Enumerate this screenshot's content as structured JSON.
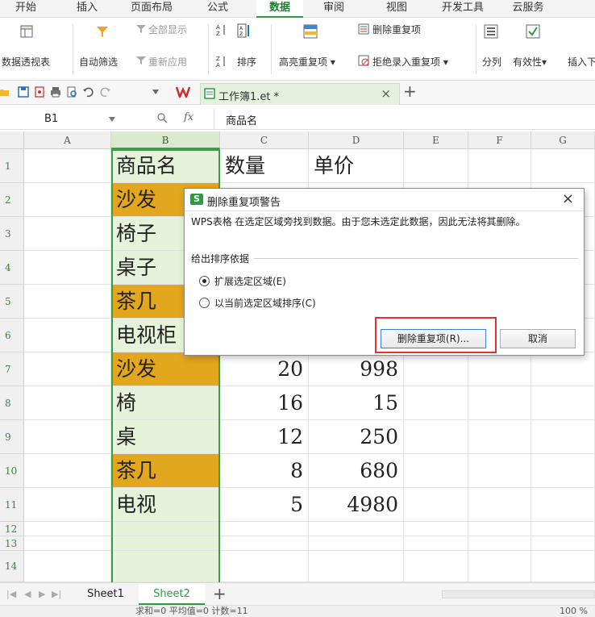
{
  "menu": {
    "tabs": [
      {
        "label": "开始"
      },
      {
        "label": "插入"
      },
      {
        "label": "页面布局"
      },
      {
        "label": "公式"
      },
      {
        "label": "数据",
        "active": true
      },
      {
        "label": "审阅"
      },
      {
        "label": "视图"
      },
      {
        "label": "开发工具"
      },
      {
        "label": "云服务"
      }
    ]
  },
  "ribbon": {
    "pivot": "数据透视表",
    "autofilter": "自动筛选",
    "show_all": "全部显示",
    "reapply": "重新应用",
    "sort": "排序",
    "highlight_dup": "高亮重复项",
    "delete_dup": "删除重复项",
    "reject_dup": "拒绝录入重复项",
    "split": "分列",
    "validity": "有效性",
    "insert_dropdown": "插入下"
  },
  "doc_tab": {
    "title": "工作簿1.et *",
    "close": "×",
    "new": "+"
  },
  "formula_bar": {
    "cell_ref": "B1",
    "fx": "fx",
    "content": "商品名"
  },
  "columns": [
    "A",
    "B",
    "C",
    "D",
    "E",
    "F",
    "G"
  ],
  "rows": [
    "1",
    "2",
    "3",
    "4",
    "5",
    "6",
    "7",
    "8",
    "9",
    "10",
    "11",
    "12",
    "13",
    "14"
  ],
  "table": {
    "headers": [
      "商品名",
      "数量",
      "单价"
    ],
    "records": [
      {
        "name": "沙发",
        "qty": "",
        "price": "",
        "hl": true
      },
      {
        "name": "椅子",
        "qty": "",
        "price": "",
        "hl": false
      },
      {
        "name": "桌子",
        "qty": "",
        "price": "",
        "hl": false
      },
      {
        "name": "茶几",
        "qty": "",
        "price": "",
        "hl": true
      },
      {
        "name": "电视柜",
        "qty": "",
        "price": "",
        "hl": false
      },
      {
        "name": "沙发",
        "qty": "20",
        "price": "998",
        "hl": true
      },
      {
        "name": "椅",
        "qty": "16",
        "price": "15",
        "hl": false
      },
      {
        "name": "桌",
        "qty": "12",
        "price": "250",
        "hl": false
      },
      {
        "name": "茶几",
        "qty": "8",
        "price": "680",
        "hl": true
      },
      {
        "name": "电视",
        "qty": "5",
        "price": "4980",
        "hl": false
      }
    ]
  },
  "dialog": {
    "icon": "S",
    "title": "删除重复项警告",
    "close": "×",
    "message": "WPS表格 在选定区域旁找到数据。由于您未选定此数据，因此无法将其删除。",
    "group_label": "给出排序依据",
    "option1": "扩展选定区域(E)",
    "option2": "以当前选定区域排序(C)",
    "ok_button": "删除重复项(R)...",
    "cancel_button": "取消"
  },
  "sheets": {
    "tabs": [
      "Sheet1",
      "Sheet2"
    ],
    "active": "Sheet2",
    "add": "+"
  },
  "status": {
    "summary": "求和=0  平均值=0  计数=11",
    "zoom": "100 %"
  },
  "colors": {
    "accent": "#2f9a45",
    "highlight": "#e3a71d",
    "selected_col": "#e6f3da",
    "callout": "#e2312f"
  }
}
